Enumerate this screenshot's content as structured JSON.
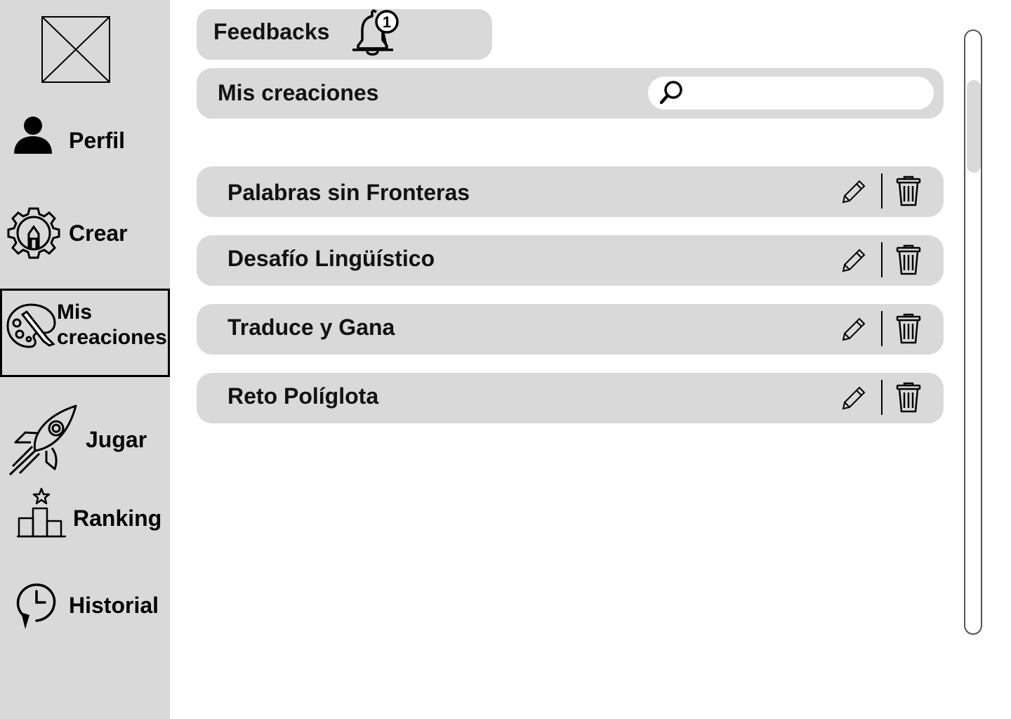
{
  "sidebar": {
    "logo": "logo-placeholder",
    "items": [
      {
        "label": "Perfil",
        "icon": "user-icon"
      },
      {
        "label": "Crear",
        "icon": "gear-pencil-icon"
      },
      {
        "label_line1": "Mis",
        "label_line2": "creaciones",
        "icon": "palette-icon",
        "active": true
      },
      {
        "label": "Jugar",
        "icon": "rocket-icon"
      },
      {
        "label": "Ranking",
        "icon": "podium-icon"
      },
      {
        "label": "Historial",
        "icon": "history-icon"
      }
    ]
  },
  "feedback": {
    "label": "Feedbacks",
    "badge_count": "1"
  },
  "section": {
    "title": "Mis creaciones",
    "search_value": "",
    "search_placeholder": ""
  },
  "creations": [
    {
      "title": "Palabras sin Fronteras"
    },
    {
      "title": "Desafío Lingüístico"
    },
    {
      "title": "Traduce y Gana"
    },
    {
      "title": "Reto Políglota"
    }
  ],
  "colors": {
    "panel": "#d9d9d9",
    "background": "#ffffff",
    "text": "#000000"
  }
}
